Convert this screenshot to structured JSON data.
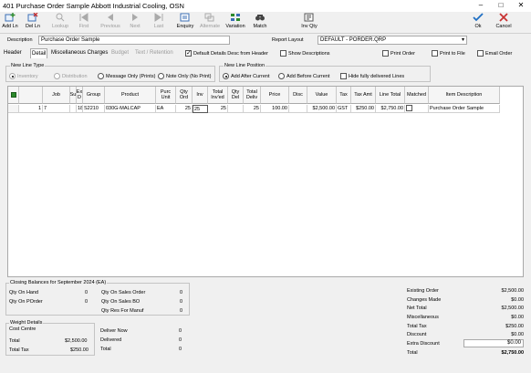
{
  "window": {
    "title": "401 Purchase Order Sample Abbott Industrial Cooling, OSN"
  },
  "toolbar": {
    "add_ln": "Add Ln",
    "del_ln": "Del Ln",
    "lookup": "Lookup",
    "first": "First",
    "previous": "Previous",
    "next": "Next",
    "last": "Last",
    "enquiry": "Enquiry",
    "alternate": "Alternate",
    "variation": "Variation",
    "match": "Match",
    "inv_qty": "Inv Qty",
    "ok": "Ok",
    "cancel": "Cancel"
  },
  "header_row": {
    "description_label": "Description",
    "description_value": "Purchase Order Sample",
    "report_layout_label": "Report Layout",
    "report_layout_value": "DEFAULT - PORDER.QRP"
  },
  "tabs": [
    "Header",
    "Detail",
    "Miscellaneous Charges",
    "Budget",
    "Text / Retention"
  ],
  "options": {
    "default_details": "Default Details Desc from Header",
    "show_descriptions": "Show Descriptions",
    "print_order": "Print Order",
    "print_to_file": "Print to File",
    "email_order": "Email Order"
  },
  "new_line_type": {
    "title": "New Line Type",
    "inventory": "Inventory",
    "distribution": "Distribution",
    "message_only": "Message Only (Prints)",
    "note_only": "Note Only (No Print)"
  },
  "new_line_position": {
    "title": "New Line Position",
    "add_after": "Add After Current",
    "add_before": "Add Before Current",
    "hide_delivered": "Hide fully delivered Lines"
  },
  "grid": {
    "headers": [
      "Job",
      "Su",
      "Ex D",
      "Group",
      "Product",
      "Purc Unit",
      "Qty Ord",
      "Inv",
      "Total Inv'ed",
      "Qty Del",
      "Total Deliv",
      "Price",
      "Disc",
      "Value",
      "Tax",
      "Tax Amt",
      "Line Total",
      "Matched",
      "Item Description"
    ],
    "row": {
      "line_no": "1",
      "job": "7",
      "su": "",
      "ex": "18",
      "group": "S2210",
      "product": "030G-MALCAP",
      "purc_unit": "EA",
      "qty_ord": "25",
      "inv": "25",
      "total_inv": "25",
      "qty_del": "",
      "total_deliv": "25",
      "price": "100.00",
      "disc": "",
      "value": "$2,500.00",
      "tax": "GST",
      "tax_amt": "$250.00",
      "line_total": "$2,750.00",
      "item_description": "Purchase Order Sample"
    }
  },
  "closing": {
    "title": "Closing Balances for September 2024 (EA)",
    "qty_on_hand": "Qty On Hand",
    "qty_on_hand_val": "0",
    "qty_on_porder": "Qty On POrder",
    "qty_on_porder_val": "0",
    "qty_on_sales_order": "Qty On Sales Order",
    "qty_on_sales_order_val": "0",
    "qty_on_sales_bo": "Qty On Sales BO",
    "qty_on_sales_bo_val": "0",
    "qty_res_manuf": "Qty Res For Manuf",
    "qty_res_manuf_val": "0"
  },
  "weight": {
    "title": "Weight Details",
    "cost_centre": "Cost Centre",
    "total": "Total",
    "total_val": "$2,500.00",
    "total_tax": "Total Tax",
    "total_tax_val": "$250.00",
    "deliver_now": "Deliver Now",
    "deliver_now_val": "0",
    "delivered": "Delivered",
    "delivered_val": "0",
    "total2": "Total",
    "total2_val": "0"
  },
  "summary": {
    "existing_order": "Existing Order",
    "existing_order_val": "$2,500.00",
    "changes_made": "Changes Made",
    "changes_made_val": "$0.00",
    "net_total": "Net Total",
    "net_total_val": "$2,500.00",
    "misc": "Miscellaneous",
    "misc_val": "$0.00",
    "total_tax": "Total Tax",
    "total_tax_val": "$250.00",
    "discount": "Discount",
    "discount_val": "$0.00",
    "extra_discount": "Extra Discount",
    "extra_discount_val": "$0.00",
    "total": "Total",
    "total_val": "$2,750.00"
  }
}
